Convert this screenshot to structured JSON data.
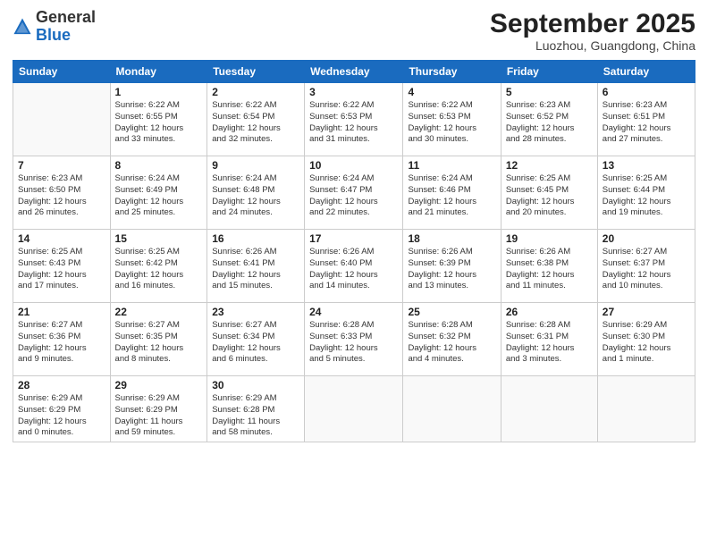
{
  "header": {
    "logo_general": "General",
    "logo_blue": "Blue",
    "month_title": "September 2025",
    "location": "Luozhou, Guangdong, China"
  },
  "weekdays": [
    "Sunday",
    "Monday",
    "Tuesday",
    "Wednesday",
    "Thursday",
    "Friday",
    "Saturday"
  ],
  "weeks": [
    [
      {
        "day": "",
        "info": ""
      },
      {
        "day": "1",
        "info": "Sunrise: 6:22 AM\nSunset: 6:55 PM\nDaylight: 12 hours\nand 33 minutes."
      },
      {
        "day": "2",
        "info": "Sunrise: 6:22 AM\nSunset: 6:54 PM\nDaylight: 12 hours\nand 32 minutes."
      },
      {
        "day": "3",
        "info": "Sunrise: 6:22 AM\nSunset: 6:53 PM\nDaylight: 12 hours\nand 31 minutes."
      },
      {
        "day": "4",
        "info": "Sunrise: 6:22 AM\nSunset: 6:53 PM\nDaylight: 12 hours\nand 30 minutes."
      },
      {
        "day": "5",
        "info": "Sunrise: 6:23 AM\nSunset: 6:52 PM\nDaylight: 12 hours\nand 28 minutes."
      },
      {
        "day": "6",
        "info": "Sunrise: 6:23 AM\nSunset: 6:51 PM\nDaylight: 12 hours\nand 27 minutes."
      }
    ],
    [
      {
        "day": "7",
        "info": "Sunrise: 6:23 AM\nSunset: 6:50 PM\nDaylight: 12 hours\nand 26 minutes."
      },
      {
        "day": "8",
        "info": "Sunrise: 6:24 AM\nSunset: 6:49 PM\nDaylight: 12 hours\nand 25 minutes."
      },
      {
        "day": "9",
        "info": "Sunrise: 6:24 AM\nSunset: 6:48 PM\nDaylight: 12 hours\nand 24 minutes."
      },
      {
        "day": "10",
        "info": "Sunrise: 6:24 AM\nSunset: 6:47 PM\nDaylight: 12 hours\nand 22 minutes."
      },
      {
        "day": "11",
        "info": "Sunrise: 6:24 AM\nSunset: 6:46 PM\nDaylight: 12 hours\nand 21 minutes."
      },
      {
        "day": "12",
        "info": "Sunrise: 6:25 AM\nSunset: 6:45 PM\nDaylight: 12 hours\nand 20 minutes."
      },
      {
        "day": "13",
        "info": "Sunrise: 6:25 AM\nSunset: 6:44 PM\nDaylight: 12 hours\nand 19 minutes."
      }
    ],
    [
      {
        "day": "14",
        "info": "Sunrise: 6:25 AM\nSunset: 6:43 PM\nDaylight: 12 hours\nand 17 minutes."
      },
      {
        "day": "15",
        "info": "Sunrise: 6:25 AM\nSunset: 6:42 PM\nDaylight: 12 hours\nand 16 minutes."
      },
      {
        "day": "16",
        "info": "Sunrise: 6:26 AM\nSunset: 6:41 PM\nDaylight: 12 hours\nand 15 minutes."
      },
      {
        "day": "17",
        "info": "Sunrise: 6:26 AM\nSunset: 6:40 PM\nDaylight: 12 hours\nand 14 minutes."
      },
      {
        "day": "18",
        "info": "Sunrise: 6:26 AM\nSunset: 6:39 PM\nDaylight: 12 hours\nand 13 minutes."
      },
      {
        "day": "19",
        "info": "Sunrise: 6:26 AM\nSunset: 6:38 PM\nDaylight: 12 hours\nand 11 minutes."
      },
      {
        "day": "20",
        "info": "Sunrise: 6:27 AM\nSunset: 6:37 PM\nDaylight: 12 hours\nand 10 minutes."
      }
    ],
    [
      {
        "day": "21",
        "info": "Sunrise: 6:27 AM\nSunset: 6:36 PM\nDaylight: 12 hours\nand 9 minutes."
      },
      {
        "day": "22",
        "info": "Sunrise: 6:27 AM\nSunset: 6:35 PM\nDaylight: 12 hours\nand 8 minutes."
      },
      {
        "day": "23",
        "info": "Sunrise: 6:27 AM\nSunset: 6:34 PM\nDaylight: 12 hours\nand 6 minutes."
      },
      {
        "day": "24",
        "info": "Sunrise: 6:28 AM\nSunset: 6:33 PM\nDaylight: 12 hours\nand 5 minutes."
      },
      {
        "day": "25",
        "info": "Sunrise: 6:28 AM\nSunset: 6:32 PM\nDaylight: 12 hours\nand 4 minutes."
      },
      {
        "day": "26",
        "info": "Sunrise: 6:28 AM\nSunset: 6:31 PM\nDaylight: 12 hours\nand 3 minutes."
      },
      {
        "day": "27",
        "info": "Sunrise: 6:29 AM\nSunset: 6:30 PM\nDaylight: 12 hours\nand 1 minute."
      }
    ],
    [
      {
        "day": "28",
        "info": "Sunrise: 6:29 AM\nSunset: 6:29 PM\nDaylight: 12 hours\nand 0 minutes."
      },
      {
        "day": "29",
        "info": "Sunrise: 6:29 AM\nSunset: 6:29 PM\nDaylight: 11 hours\nand 59 minutes."
      },
      {
        "day": "30",
        "info": "Sunrise: 6:29 AM\nSunset: 6:28 PM\nDaylight: 11 hours\nand 58 minutes."
      },
      {
        "day": "",
        "info": ""
      },
      {
        "day": "",
        "info": ""
      },
      {
        "day": "",
        "info": ""
      },
      {
        "day": "",
        "info": ""
      }
    ]
  ]
}
